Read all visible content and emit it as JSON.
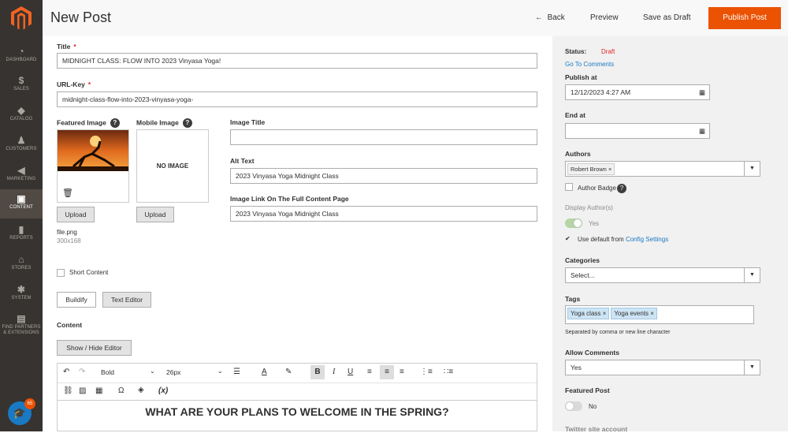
{
  "sidebar": {
    "items": [
      {
        "label": "DASHBOARD"
      },
      {
        "label": "SALES"
      },
      {
        "label": "CATALOG"
      },
      {
        "label": "CUSTOMERS"
      },
      {
        "label": "MARKETING"
      },
      {
        "label": "CONTENT"
      },
      {
        "label": "REPORTS"
      },
      {
        "label": "STORES"
      },
      {
        "label": "SYSTEM"
      },
      {
        "label": "FIND PARTNERS & EXTENSIONS"
      }
    ],
    "badge_count": "65"
  },
  "header": {
    "title": "New Post",
    "back_label": "Back",
    "preview_label": "Preview",
    "save_draft_label": "Save as Draft",
    "publish_label": "Publish Post"
  },
  "form": {
    "title_label": "Title",
    "title_value": "MIDNIGHT CLASS: FLOW INTO 2023 Vinyasa Yoga!",
    "urlkey_label": "URL-Key",
    "urlkey_value": "midnight-class-flow-into-2023-vinyasa-yoga-",
    "featured_image_label": "Featured Image",
    "mobile_image_label": "Mobile Image",
    "no_image_text": "NO IMAGE",
    "upload_label": "Upload",
    "file_name": "file.png",
    "file_dims": "300x168",
    "image_title_label": "Image Title",
    "image_title_value": "",
    "alt_text_label": "Alt Text",
    "alt_text_value": "2023 Vinyasa Yoga Midnight Class",
    "image_link_label": "Image Link On The Full Content Page",
    "image_link_value": "2023 Vinyasa Yoga Midnight Class",
    "short_content_label": "Short Content",
    "buildify_label": "Buildify",
    "text_editor_label": "Text Editor",
    "content_label": "Content",
    "show_hide_label": "Show / Hide Editor"
  },
  "editor": {
    "font_weight": "Bold",
    "font_size": "26px",
    "heading_text": "WHAT ARE YOUR PLANS TO WELCOME IN THE SPRING?"
  },
  "panel": {
    "status_label": "Status:",
    "status_value": "Draft",
    "go_to_comments": "Go To Comments",
    "publish_at_label": "Publish at",
    "publish_at_value": "12/12/2023 4:27 AM",
    "end_at_label": "End at",
    "end_at_value": "",
    "authors_label": "Authors",
    "author_tag": "Robert Brown",
    "author_badge_label": "Author Badge",
    "display_authors_label": "Display Author(s)",
    "display_authors_value": "Yes",
    "use_default_text": "Use default from",
    "config_settings_link": "Config Settings",
    "categories_label": "Categories",
    "categories_value": "Select...",
    "tags_label": "Tags",
    "tags": [
      "Yoga class",
      "Yoga events"
    ],
    "tags_hint": "Separated by comma or new line character",
    "allow_comments_label": "Allow Comments",
    "allow_comments_value": "Yes",
    "featured_post_label": "Featured Post",
    "featured_post_value": "No",
    "twitter_label": "Twitter site account"
  },
  "colors": {
    "accent": "#eb5202",
    "sidebar": "#373330",
    "link": "#1979c3",
    "status_draft": "#e22626"
  }
}
